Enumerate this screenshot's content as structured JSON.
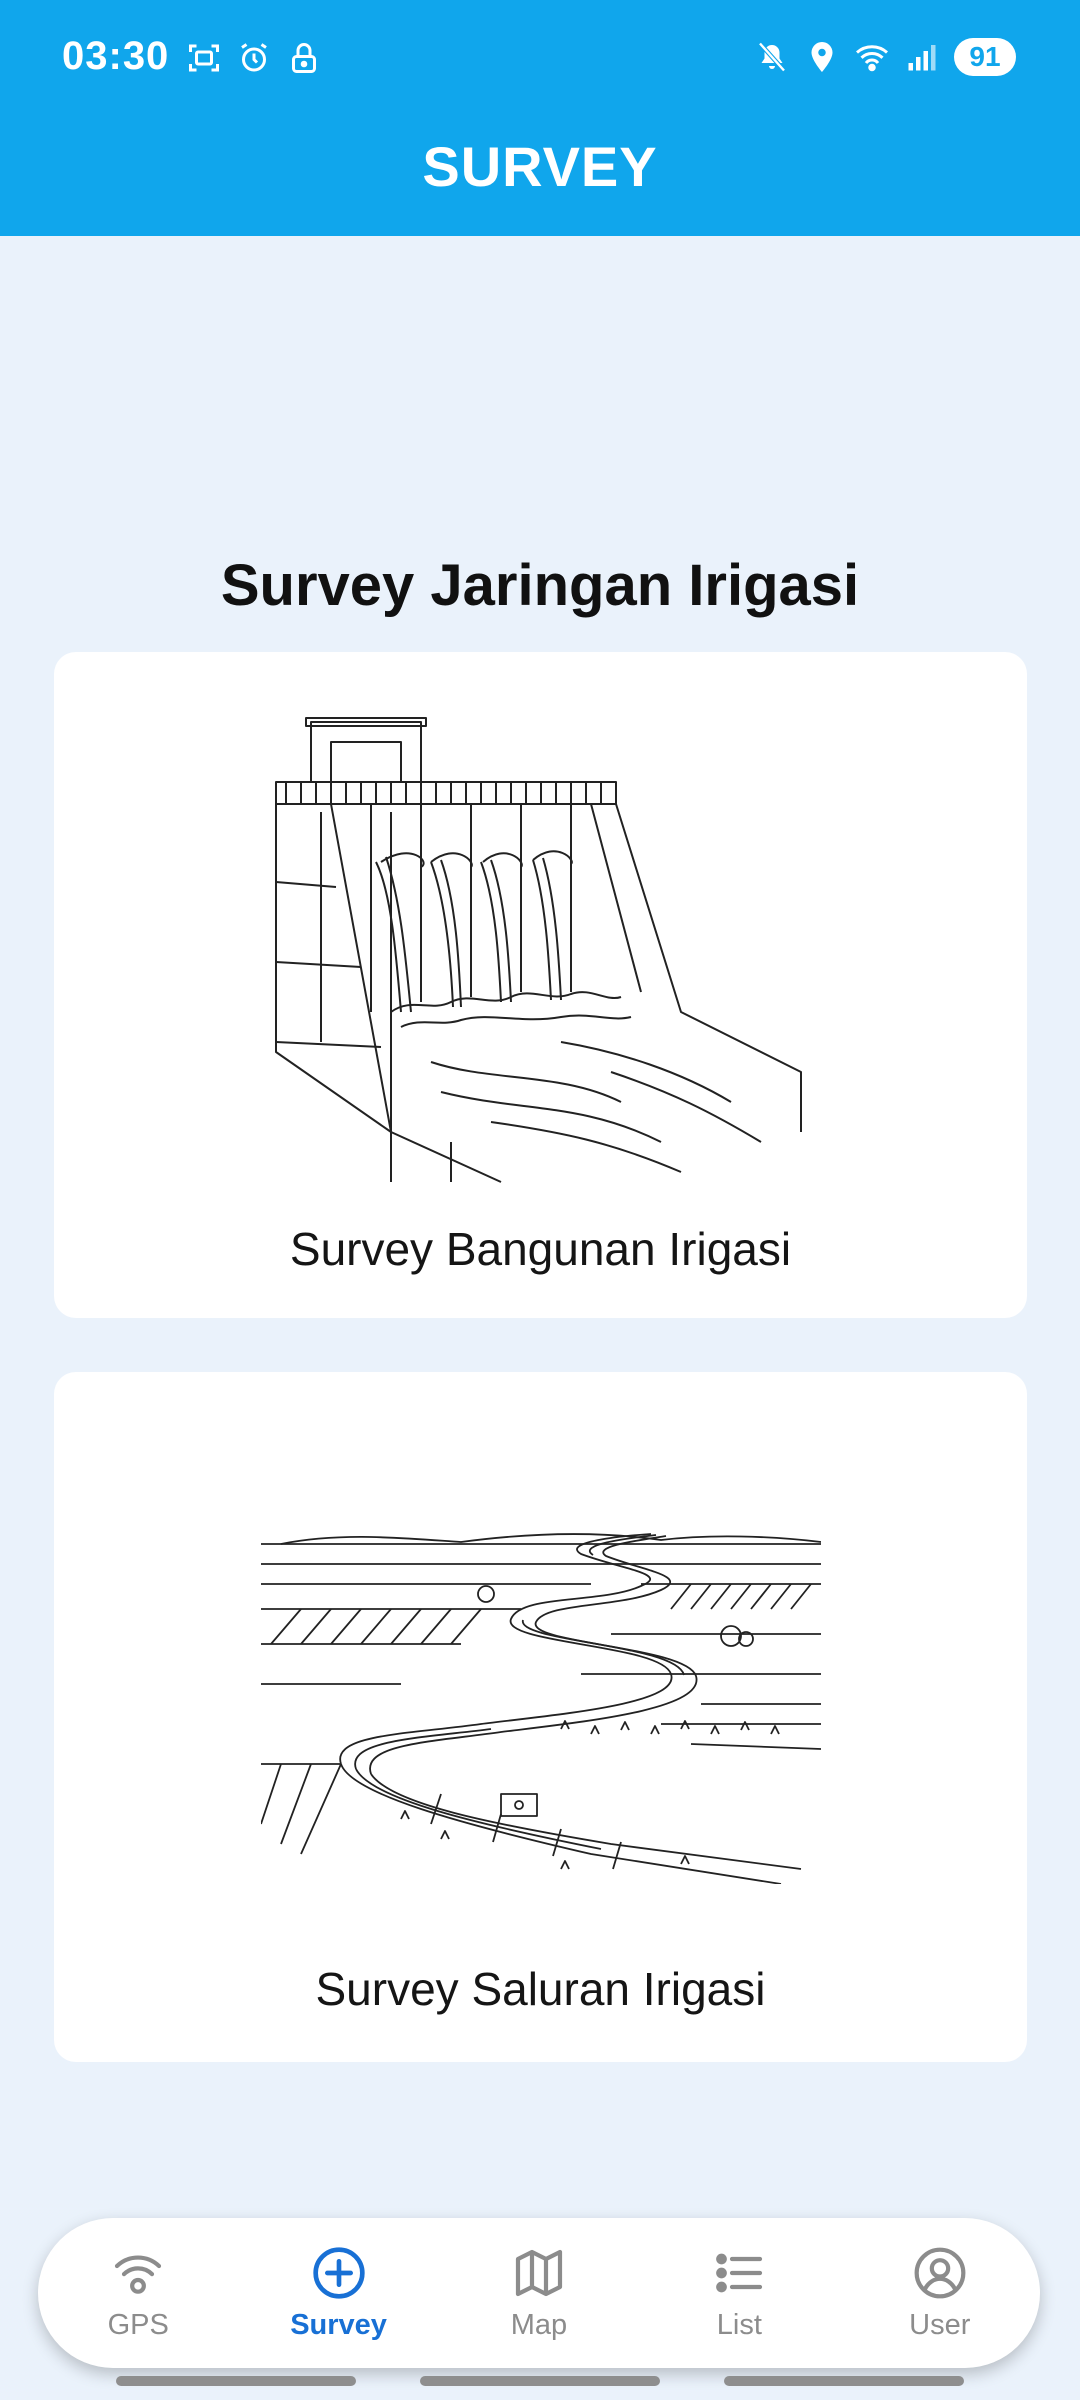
{
  "status_bar": {
    "time": "03:30",
    "battery": "91",
    "icons_left": [
      "screenshot-icon",
      "alarm-icon",
      "lock-icon"
    ],
    "icons_right": [
      "mute-icon",
      "location-icon",
      "wifi-icon",
      "signal-icon"
    ]
  },
  "header": {
    "title": "SURVEY",
    "background": "#10A6EC"
  },
  "main": {
    "heading": "Survey Jaringan Irigasi",
    "cards": [
      {
        "label": "Survey Bangunan Irigasi",
        "illustration": "dam-spillway-illustration"
      },
      {
        "label": "Survey Saluran Irigasi",
        "illustration": "irrigation-canal-illustration"
      }
    ]
  },
  "bottom_nav": {
    "items": [
      {
        "label": "GPS",
        "icon": "gps-signal-icon",
        "active": false
      },
      {
        "label": "Survey",
        "icon": "add-circle-icon",
        "active": true
      },
      {
        "label": "Map",
        "icon": "map-icon",
        "active": false
      },
      {
        "label": "List",
        "icon": "list-icon",
        "active": false
      },
      {
        "label": "User",
        "icon": "user-icon",
        "active": false
      }
    ],
    "active_color": "#1870D5",
    "inactive_color": "#8C8C8C"
  }
}
